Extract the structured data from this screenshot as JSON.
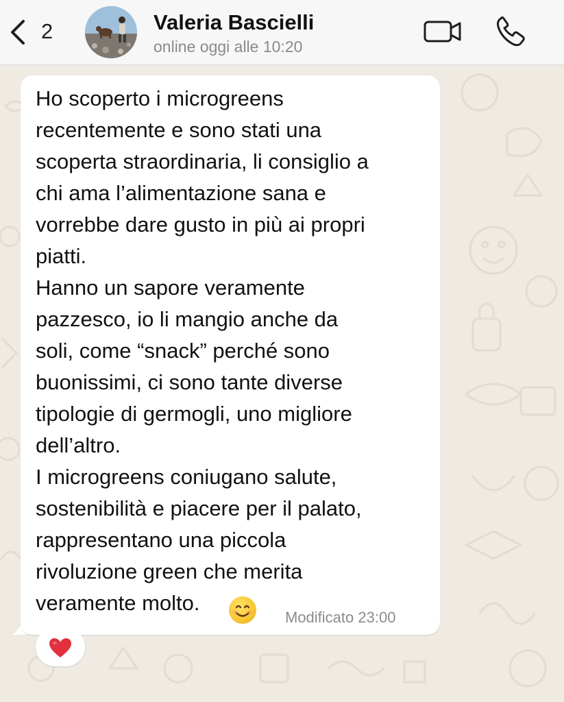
{
  "header": {
    "back_icon": "chevron-left-icon",
    "unread_count": "2",
    "contact_name": "Valeria Bascielli",
    "status": "online oggi alle 10:20",
    "video_icon": "video-camera-icon",
    "call_icon": "phone-icon"
  },
  "message": {
    "lines": [
      "Ho scoperto i microgreens",
      "recentemente e sono stati una",
      "scoperta straordinaria, li consiglio a",
      "chi ama l’alimentazione sana e",
      "vorrebbe dare gusto in più ai propri",
      "piatti.",
      "Hanno un sapore veramente",
      "pazzesco, io li mangio anche da",
      "soli, come “snack” perché sono",
      "buonissimi, ci sono tante diverse",
      "tipologie di germogli, uno migliore",
      "dell’altro.",
      "I microgreens coniugano salute,",
      "sostenibilità e piacere per il palato,",
      "rappresentano una piccola",
      "rivoluzione green che merita",
      "veramente molto."
    ],
    "emoji": "smiling-face-emoji",
    "timestamp": "Modificato 23:00",
    "reaction": "red-heart-emoji"
  },
  "colors": {
    "header_bg": "#F7F7F7",
    "chat_bg": "#EFEAE2",
    "bubble_bg": "#FFFFFF",
    "icon_color": "#1F1F1F",
    "status_color": "#8A8A8A",
    "heart": "#E0313D"
  }
}
